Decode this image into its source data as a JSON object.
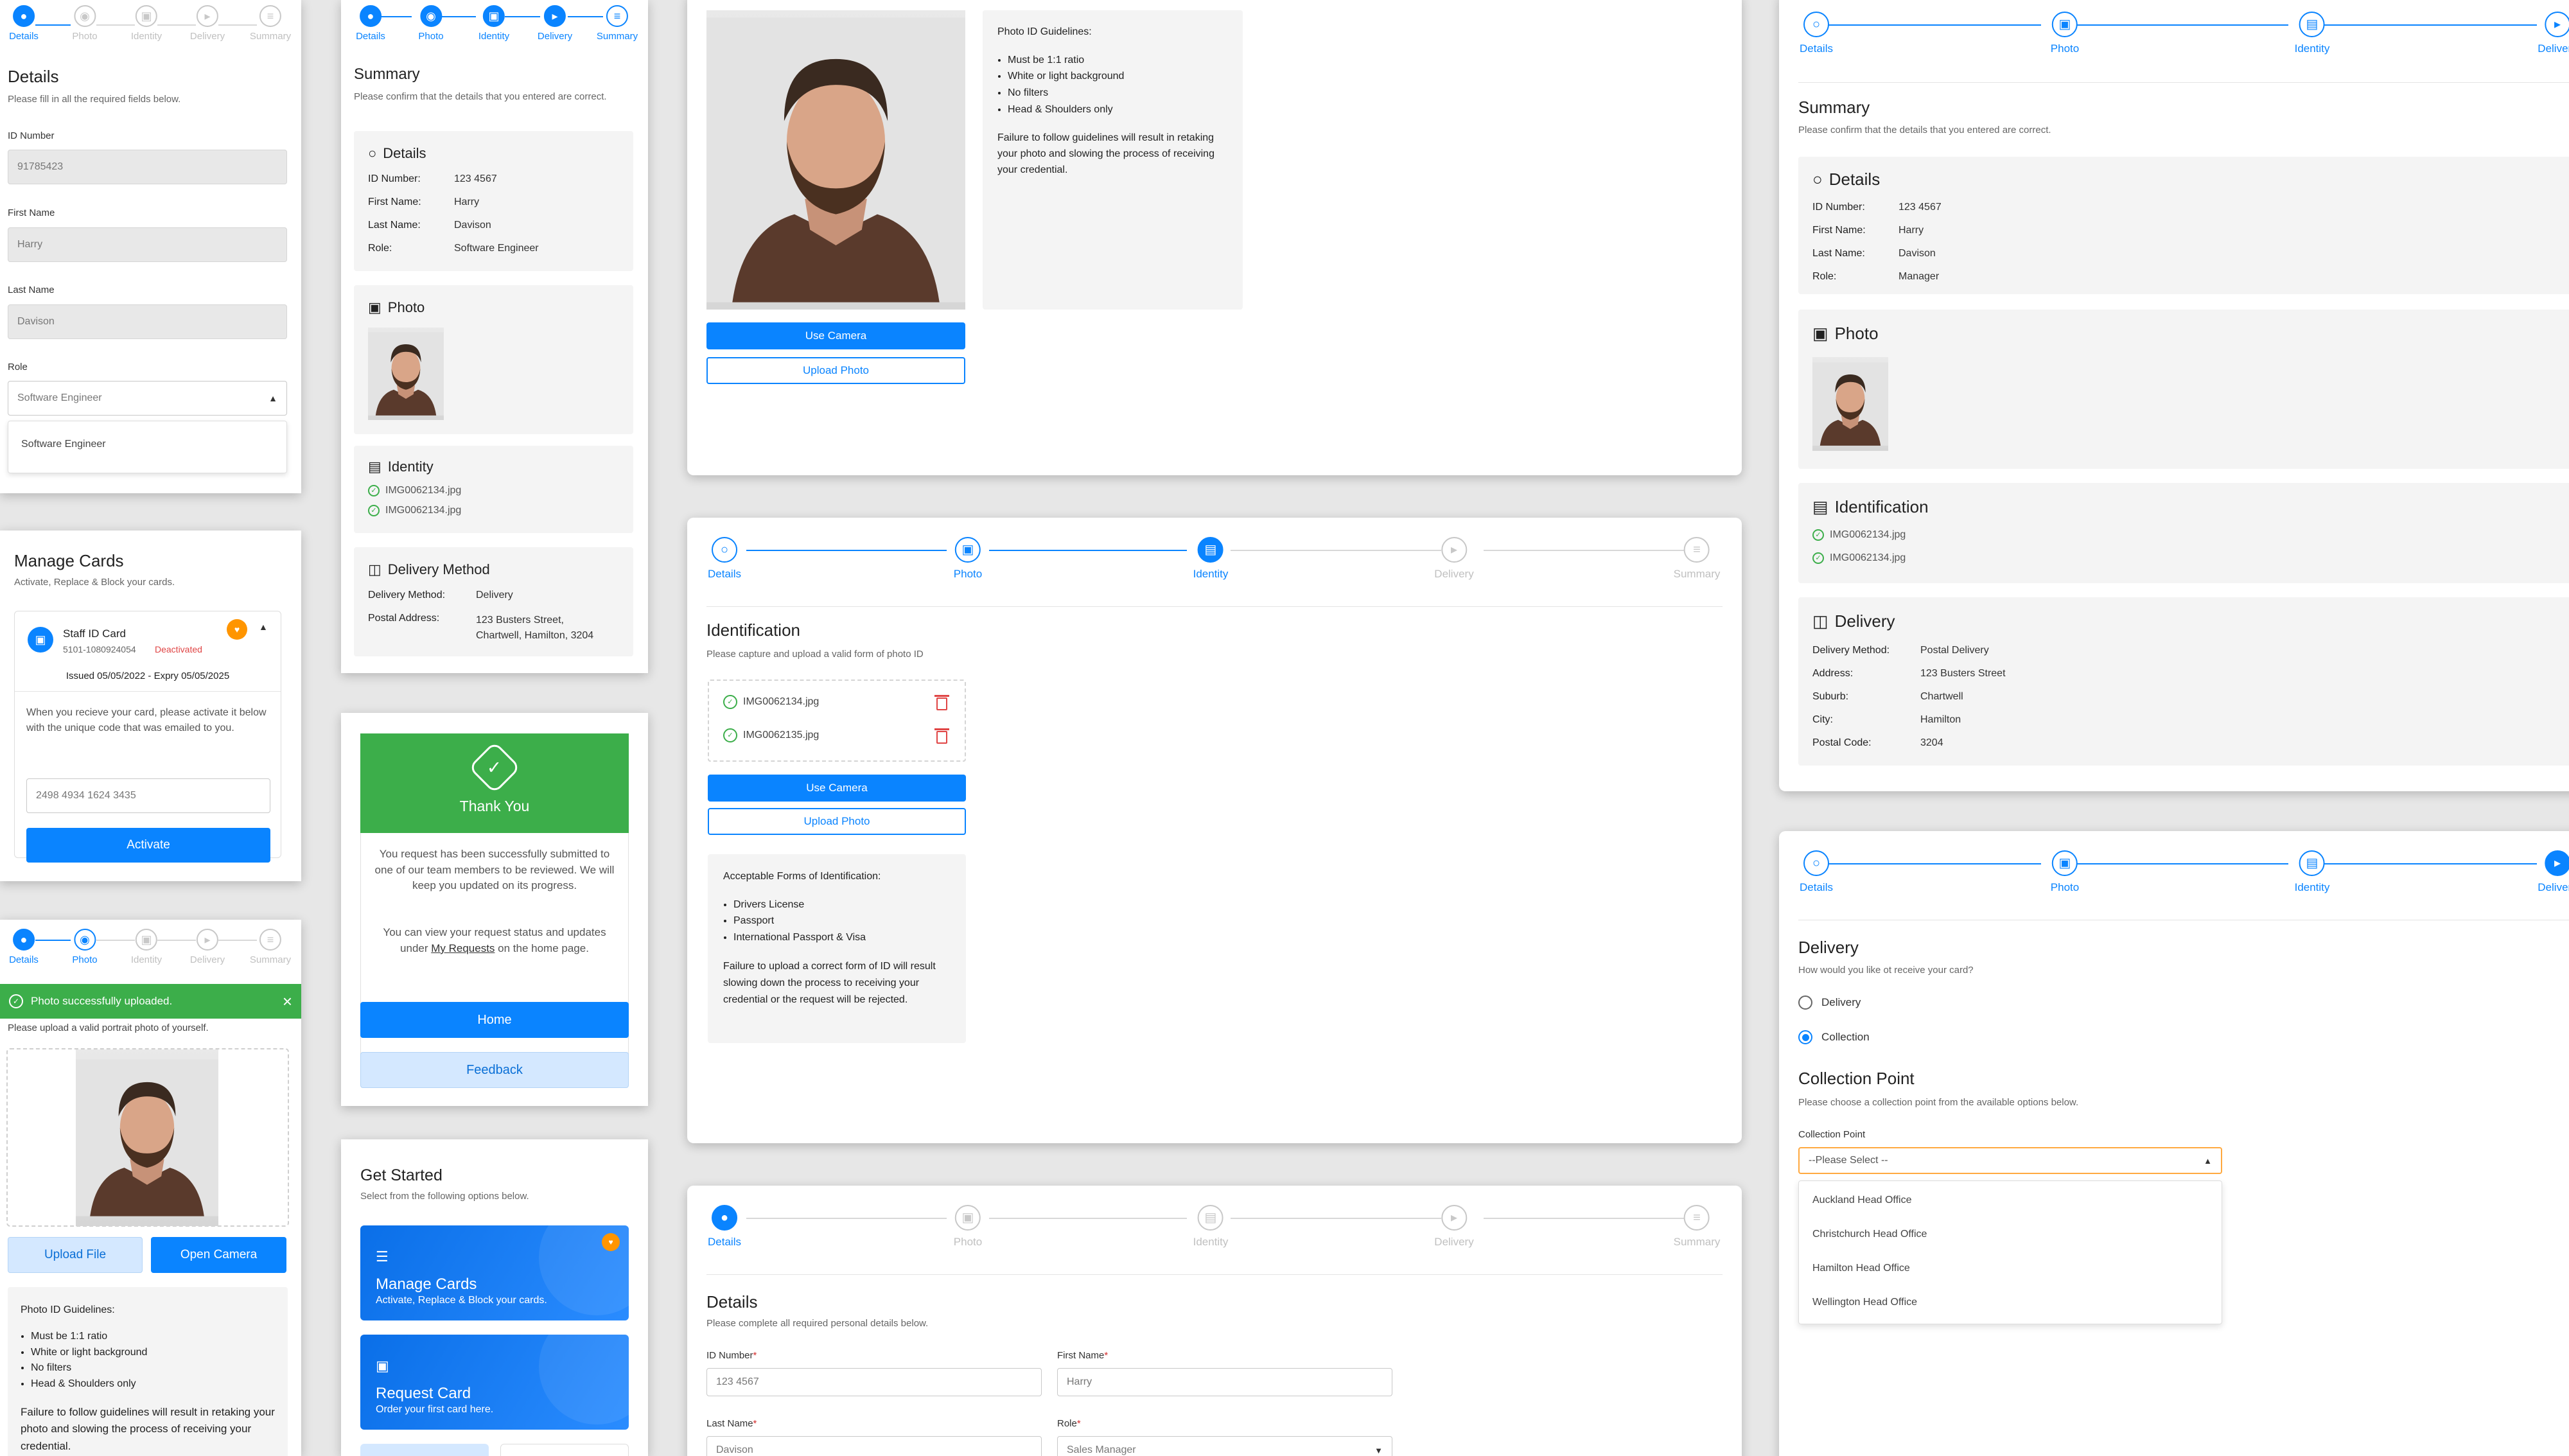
{
  "colors": {
    "primary": "#0a84ff",
    "success": "#3cae4a",
    "danger": "#e04545",
    "warning": "#ff9500"
  },
  "steps": [
    "Details",
    "Photo",
    "Identity",
    "Delivery",
    "Summary"
  ],
  "details_mobile": {
    "title": "Details",
    "subtitle": "Please fill in all the required fields below.",
    "id_label": "ID Number",
    "id_value": "91785423",
    "first_label": "First Name",
    "first_value": "Harry",
    "last_label": "Last Name",
    "last_value": "Davison",
    "role_label": "Role",
    "role_value": "Software Engineer",
    "role_option": "Software Engineer"
  },
  "manage_cards": {
    "title": "Manage Cards",
    "subtitle": "Activate, Replace & Block your cards.",
    "card_name": "Staff ID Card",
    "card_number": "5101-1080924054",
    "card_status": "Deactivated",
    "issued": "Issued 05/05/2022 - Expry 05/05/2025",
    "instructions": "When you recieve your card, please activate it below with the unique code that was emailed to you.",
    "code": "2498 4934 1624 3435",
    "activate": "Activate"
  },
  "photo_mobile": {
    "toast": "Photo successfully uploaded.",
    "instruction": "Please upload a valid portrait photo of yourself.",
    "upload_file": "Upload File",
    "open_camera": "Open Camera",
    "guidelines_title": "Photo ID Guidelines:",
    "guidelines": [
      "Must be 1:1 ratio",
      "White or light background",
      "No filters",
      "Head & Shoulders only"
    ],
    "warning": "Failure to follow guidelines will result in retaking your photo and slowing the process of receiving your credential."
  },
  "summary_mobile": {
    "title": "Summary",
    "subtitle": "Please confirm that the details that you entered are correct.",
    "details_title": "Details",
    "rows": [
      [
        "ID Number:",
        "123 4567"
      ],
      [
        "First Name:",
        "Harry"
      ],
      [
        "Last Name:",
        "Davison"
      ],
      [
        "Role:",
        "Software Engineer"
      ]
    ],
    "photo_title": "Photo",
    "identity_title": "Identity",
    "files": [
      "IMG0062134.jpg",
      "IMG0062134.jpg"
    ],
    "delivery_title": "Delivery Method",
    "delivery_method_label": "Delivery Method:",
    "delivery_method": "Delivery",
    "postal_label": "Postal Address:",
    "postal_line1": "123 Busters Street,",
    "postal_line2": "Chartwell, Hamilton, 3204"
  },
  "thankyou": {
    "title": "Thank You",
    "message": "You request has been successfully submitted to one of our team members to be reviewed. We will keep you updated on its progress.",
    "view_pre": "You can view your request status and updates under ",
    "view_link": "My Requests",
    "view_post": " on the home page.",
    "home": "Home",
    "feedback": "Feedback"
  },
  "get_started": {
    "title": "Get Started",
    "subtitle": "Select from the following options below.",
    "manage_title": "Manage Cards",
    "manage_desc": "Activate, Replace & Block your cards.",
    "request_title": "Request Card",
    "request_desc": "Order your first card here."
  },
  "photo_desktop": {
    "use_camera": "Use Camera",
    "upload_photo": "Upload Photo",
    "guidelines_title": "Photo ID Guidelines:",
    "guidelines": [
      "Must be 1:1 ratio",
      "White or light background",
      "No filters",
      "Head & Shoulders only"
    ],
    "warning": "Failure to follow guidelines will result in retaking your photo and slowing the process of receiving your credential."
  },
  "identity_desktop": {
    "title": "Identification",
    "subtitle": "Please capture and upload a valid form of photo ID",
    "files": [
      "IMG0062134.jpg",
      "IMG0062135.jpg"
    ],
    "use_camera": "Use Camera",
    "upload_photo": "Upload Photo",
    "forms_title": "Acceptable Forms of Identification:",
    "forms": [
      "Drivers License",
      "Passport",
      "International Passport & Visa"
    ],
    "warning": "Failure to upload a correct form of ID will result slowing down the process to receiving your credential or the request will be rejected."
  },
  "details_desktop": {
    "title": "Details",
    "subtitle": "Please complete all required personal details below.",
    "id_label": "ID Number",
    "id_value": "123 4567",
    "first_label": "First Name",
    "first_value": "Harry",
    "last_label": "Last Name",
    "last_value": "Davison",
    "role_label": "Role",
    "role_value": "Sales Manager",
    "req": "*"
  },
  "summary_desktop": {
    "title": "Summary",
    "subtitle": "Please confirm that the details that you entered are correct.",
    "details_title": "Details",
    "rows": [
      [
        "ID Number:",
        "123 4567"
      ],
      [
        "First Name:",
        "Harry"
      ],
      [
        "Last Name:",
        "Davison"
      ],
      [
        "Role:",
        "Manager"
      ]
    ],
    "photo_title": "Photo",
    "ident_title": "Identification",
    "files": [
      "IMG0062134.jpg",
      "IMG0062134.jpg"
    ],
    "delivery_title": "Delivery",
    "delivery_rows": [
      [
        "Delivery Method:",
        "Postal Delivery"
      ],
      [
        "Address:",
        "123 Busters Street"
      ],
      [
        "Suburb:",
        "Chartwell"
      ],
      [
        "City:",
        "Hamilton"
      ],
      [
        "Postal Code:",
        "3204"
      ]
    ]
  },
  "delivery_desktop": {
    "title": "Delivery",
    "subtitle": "How would you like ot receive your card?",
    "opt_delivery": "Delivery",
    "opt_collection": "Collection",
    "cp_title": "Collection Point",
    "cp_subtitle": "Please choose a collection point from the available options below.",
    "cp_label": "Collection Point",
    "cp_placeholder": "--Please Select --",
    "cp_options": [
      "Auckland Head Office",
      "Christchurch Head Office",
      "Hamilton Head Office",
      "Wellington Head Office"
    ]
  }
}
